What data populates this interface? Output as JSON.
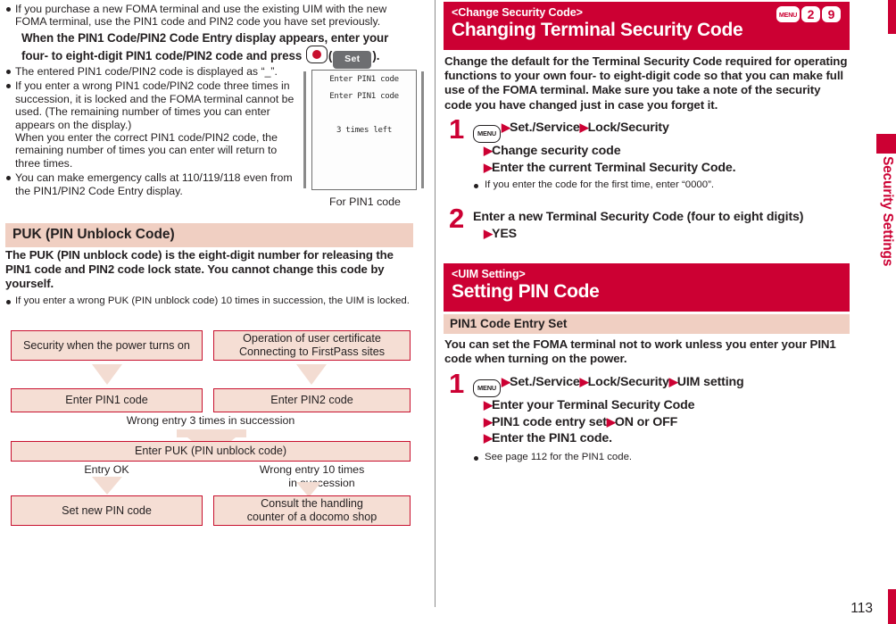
{
  "page_number": "113",
  "side_tab": "Security Settings",
  "left_column": {
    "intro_bullets": [
      "If you purchase a new FOMA terminal and use the existing UIM with the new FOMA terminal, use the PIN1 code and PIN2 code you have set previously."
    ],
    "lead_paragraph": {
      "part1": "When the PIN1 Code/PIN2 Code Entry display appears, enter your four- to eight-digit PIN1 code/PIN2 code and press ",
      "softkey_label": "Set",
      "part2": "."
    },
    "after_lead_bullets": [
      "The entered PIN1 code/PIN2 code is displayed as “_”.",
      "If you enter a wrong PIN1 code/PIN2 code three times in succession, it is locked and the FOMA terminal cannot be used. (The remaining number of times you can enter appears on the display.)\nWhen you enter the correct PIN1 code/PIN2 code, the remaining number of times you can enter will return to three times.",
      "You can make emergency calls at 110/119/118 even from the PIN1/PIN2 Code Entry display."
    ],
    "phone_figure": {
      "line1": "Enter PIN1 code",
      "line2": "Enter PIN1 code",
      "line3": "3 times left",
      "caption": "For PIN1 code"
    },
    "puk_section": {
      "heading": "PUK (PIN Unblock Code)",
      "lead": "The PUK (PIN unblock code) is the eight-digit number for releasing the PIN1 code and PIN2 code lock state. You cannot change this code by yourself.",
      "bullets": [
        "If you enter a wrong PUK (PIN unblock code) 10 times in succession, the UIM is locked."
      ]
    },
    "flowchart": {
      "box_power": "Security when the power turns on",
      "box_cert_line1": "Operation of user certificate",
      "box_cert_line2": "Connecting to FirstPass sites",
      "box_pin1": "Enter PIN1 code",
      "box_pin2": "Enter PIN2 code",
      "label_wrong3": "Wrong entry 3 times in succession",
      "box_puk": "Enter PUK (PIN unblock code)",
      "label_entry_ok": "Entry OK",
      "label_wrong10_line1": "Wrong entry 10 times",
      "label_wrong10_line2": "in succession",
      "box_setnew": "Set new PIN code",
      "box_consult_line1": "Consult the handling",
      "box_consult_line2": "counter of a docomo shop"
    }
  },
  "right_column": {
    "section1": {
      "kicker": "<Change Security Code>",
      "title": "Changing Terminal Security Code",
      "keys": [
        "MENU",
        "2",
        "9"
      ],
      "lead": "Change the default for the Terminal Security Code required for operating functions to your own four- to eight-digit code so that you can make full use of the FOMA terminal. Make sure you take a note of the security code you have changed just in case you forget it.",
      "steps": [
        {
          "num": "1",
          "lines": [
            "MENU ▶Set./Service▶Lock/Security",
            "▶Change security code",
            "▶Enter the current Terminal Security Code."
          ],
          "notes": [
            "If you enter the code for the first time, enter “0000”."
          ]
        },
        {
          "num": "2",
          "lines": [
            "Enter a new Terminal Security Code (four to eight digits)",
            "▶YES"
          ],
          "notes": []
        }
      ]
    },
    "section2": {
      "kicker": "<UIM Setting>",
      "title": "Setting PIN Code",
      "subheading": "PIN1 Code Entry Set",
      "lead": "You can set the FOMA terminal not to work unless you enter your PIN1 code when turning on the power.",
      "steps": [
        {
          "num": "1",
          "lines": [
            "MENU ▶Set./Service▶Lock/Security▶UIM setting",
            "▶Enter your Terminal Security Code",
            "▶PIN1 code entry set▶ON or OFF",
            "▶Enter the PIN1 code."
          ],
          "notes": [
            "See page 112 for the PIN1 code."
          ]
        }
      ]
    }
  },
  "colors": {
    "brand_red": "#cc0033",
    "border_red": "#c8102e",
    "pink_bar": "#f0cfc2",
    "flow_fill": "#f5ded4",
    "arrow_fill": "#f3dcd2"
  }
}
